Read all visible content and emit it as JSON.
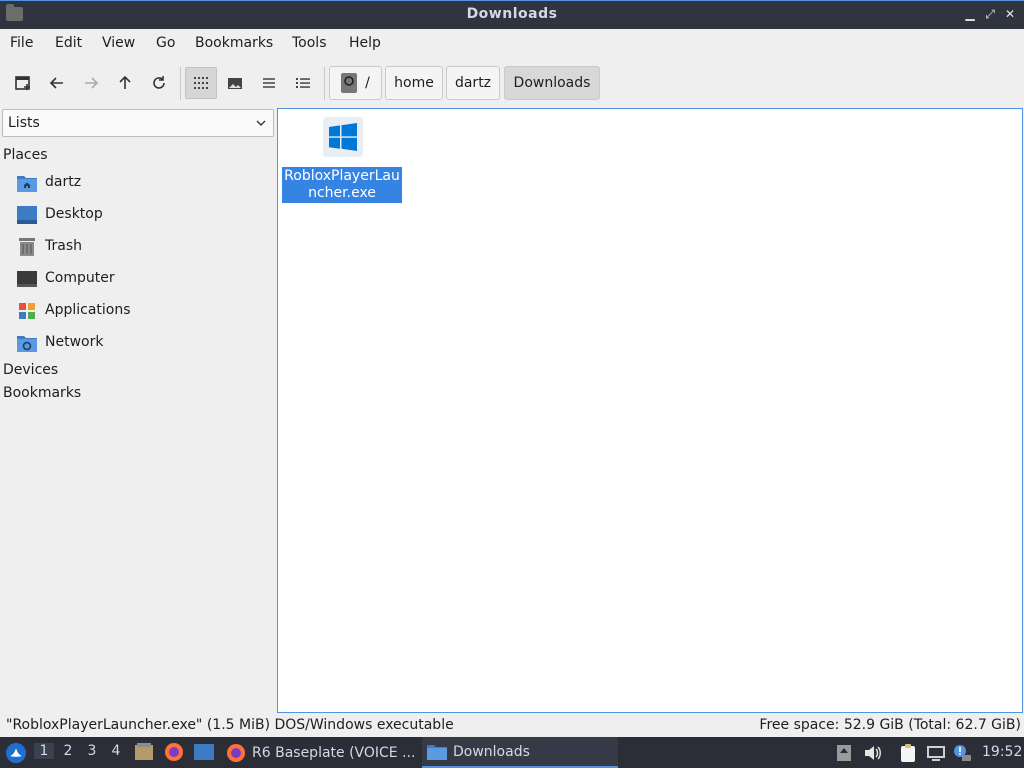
{
  "window": {
    "title": "Downloads",
    "buttons": {
      "minimize": "▁",
      "maximize": "⤢",
      "close": "✕"
    }
  },
  "menu": [
    "File",
    "Edit",
    "View",
    "Go",
    "Bookmarks",
    "Tools",
    "Help"
  ],
  "path": {
    "root": "/",
    "segments": [
      "home",
      "dartz",
      "Downloads"
    ]
  },
  "sidebar": {
    "combo": "Lists",
    "places_header": "Places",
    "places": [
      {
        "label": "dartz",
        "icon": "home-folder-icon"
      },
      {
        "label": "Desktop",
        "icon": "desktop-icon"
      },
      {
        "label": "Trash",
        "icon": "trash-icon"
      },
      {
        "label": "Computer",
        "icon": "computer-icon"
      },
      {
        "label": "Applications",
        "icon": "applications-icon"
      },
      {
        "label": "Network",
        "icon": "network-folder-icon"
      }
    ],
    "devices_header": "Devices",
    "bookmarks_header": "Bookmarks"
  },
  "files": [
    {
      "name": "RobloxPlayerLauncher.exe",
      "icon": "windows-executable-icon",
      "selected": true
    }
  ],
  "status": {
    "left": "\"RobloxPlayerLauncher.exe\" (1.5 MiB) DOS/Windows executable",
    "right": "Free space: 52.9 GiB (Total: 62.7 GiB)"
  },
  "taskbar": {
    "workspaces": [
      "1",
      "2",
      "3",
      "4"
    ],
    "active_workspace": "1",
    "tasks": [
      {
        "label": "R6 Baseplate (VOICE ...",
        "icon": "firefox-icon"
      },
      {
        "label": "Downloads",
        "icon": "folder-icon",
        "active": true
      }
    ],
    "clock": "19:52"
  },
  "colors": {
    "accent": "#5294e2",
    "selection": "#3584e4",
    "titlebar": "#2f343f",
    "taskbar": "#2b2e37"
  }
}
